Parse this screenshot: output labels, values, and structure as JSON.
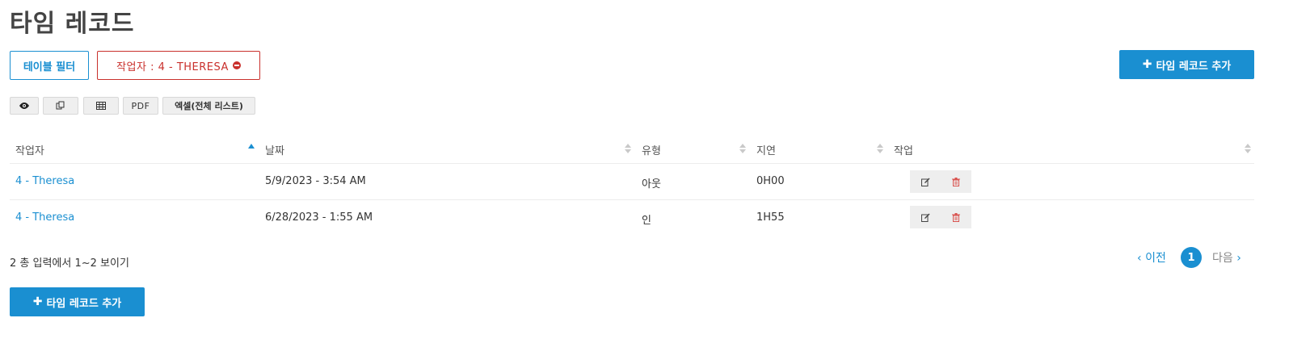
{
  "page": {
    "title": "타임 레코드"
  },
  "filters": {
    "table_filter_label": "테이블 필터",
    "worker_filter_label": "작업자 : 4 - THERESA"
  },
  "actions": {
    "add_time_record_label": "타임 레코드 추가"
  },
  "toolbar": {
    "view_icon": "eye-icon",
    "copy_icon": "copy-icon",
    "table_icon": "table-icon",
    "pdf_label": "PDF",
    "excel_label": "엑셀(전체 리스트)"
  },
  "table": {
    "columns": [
      "작업자",
      "날짜",
      "유형",
      "지연",
      "작업"
    ],
    "sorted_column": "작업자",
    "sort_direction": "asc",
    "rows": [
      {
        "worker": "4 - Theresa",
        "date": "5/9/2023 - 3:54 AM",
        "type": "아웃",
        "delay": "0H00"
      },
      {
        "worker": "4 - Theresa",
        "date": "6/28/2023 - 1:55 AM",
        "type": "인",
        "delay": "1H55"
      }
    ]
  },
  "info": {
    "text": "2 총 입력에서 1~2 보이기"
  },
  "pagination": {
    "prev_label": "이전",
    "current_page": "1",
    "next_label": "다음"
  },
  "colors": {
    "primary": "#1a8fd1",
    "danger": "#c9302c"
  }
}
